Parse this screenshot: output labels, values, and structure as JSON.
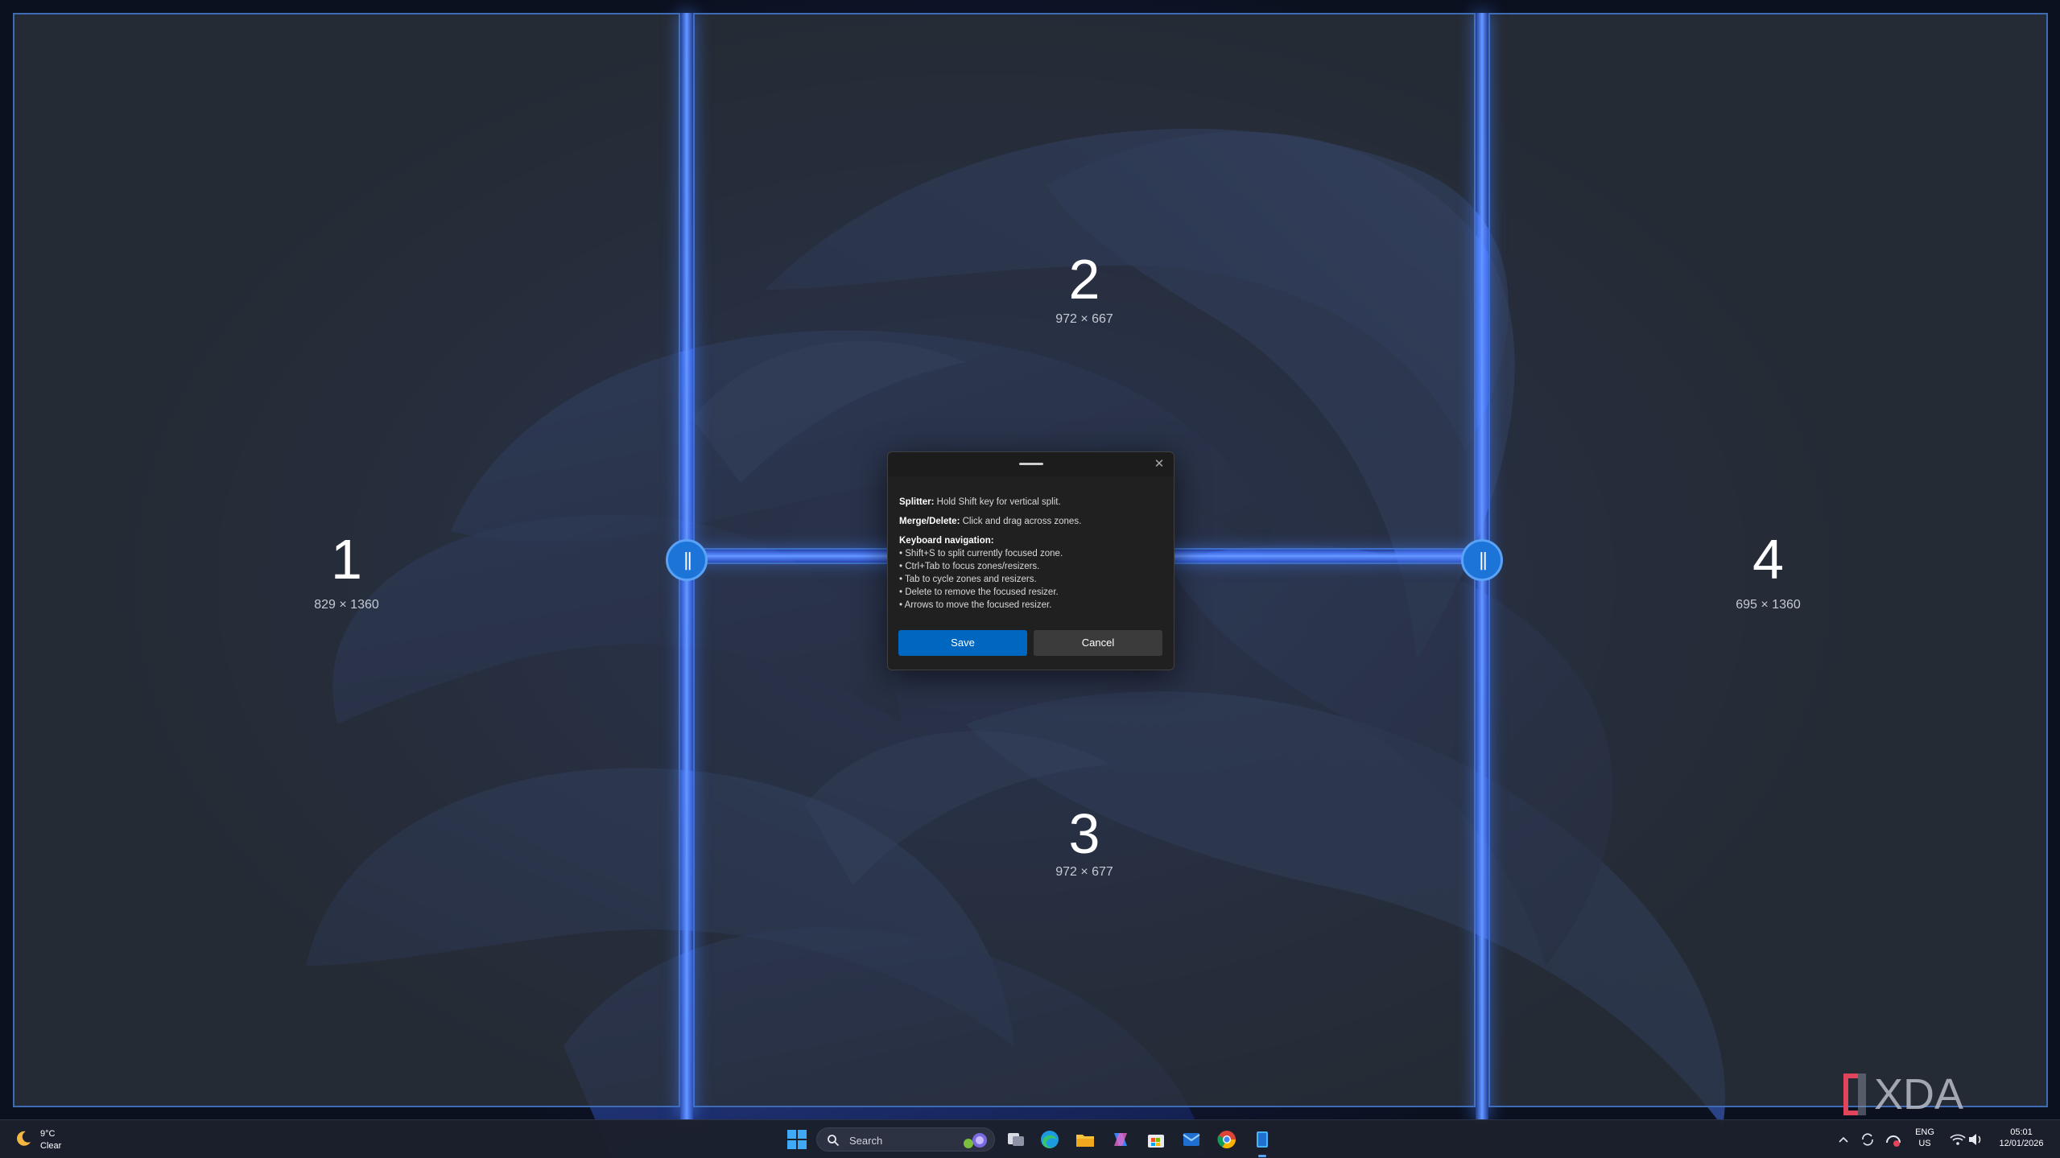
{
  "zones": [
    {
      "number": "1",
      "size": "829 × 1360"
    },
    {
      "number": "2",
      "size": "972 × 667"
    },
    {
      "number": "3",
      "size": "972 × 677"
    },
    {
      "number": "4",
      "size": "695 × 1360"
    }
  ],
  "dialog": {
    "splitter_label": "Splitter:",
    "splitter_text": " Hold Shift key for vertical split.",
    "merge_label": "Merge/Delete:",
    "merge_text": " Click and drag across zones.",
    "keyboard_label": "Keyboard navigation:",
    "keyboard_items": [
      "• Shift+S to split currently focused zone.",
      "• Ctrl+Tab to focus zones/resizers.",
      "• Tab to cycle zones and resizers.",
      "• Delete to remove the focused resizer.",
      "• Arrows to move the focused resizer."
    ],
    "save_label": "Save",
    "cancel_label": "Cancel",
    "close_glyph": "✕"
  },
  "taskbar": {
    "weather": {
      "temp": "9°C",
      "condition": "Clear",
      "icon": "moon-icon"
    },
    "search_placeholder": "Search",
    "apps": [
      "start-icon",
      "search-icon",
      "task-view-icon",
      "edge-icon",
      "file-explorer-icon",
      "copilot-icon",
      "store-icon",
      "outlook-icon",
      "chrome-icon",
      "powertoys-icon"
    ],
    "tray": {
      "lang_top": "ENG",
      "lang_bottom": "US",
      "time": "05:01",
      "date": "12/01/2026"
    }
  },
  "watermark": "XDA",
  "colors": {
    "zone_border": "#3e6bb3",
    "splitter": "#5b8dff",
    "handle": "#1c74d8",
    "save_button": "#0067c0",
    "cancel_button": "#3b3b3b"
  }
}
